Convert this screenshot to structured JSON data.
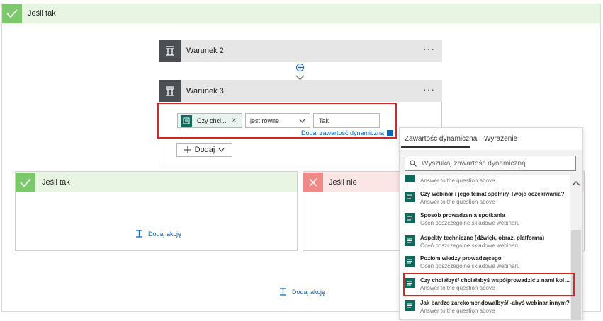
{
  "outer": {
    "title": "Jeśli tak",
    "add_action": "Dodaj akcję"
  },
  "condition2": {
    "title": "Warunek 2",
    "menu": "···"
  },
  "condition3": {
    "title": "Warunek 3",
    "menu": "···",
    "token": "Czy chci...",
    "token_remove": "×",
    "operator": "jest równe",
    "value": "Tak",
    "dynamic_link": "Dodaj zawartość dynamiczną",
    "add_button": "Dodaj"
  },
  "branch_yes": {
    "title": "Jeśli tak",
    "add_action": "Dodaj akcję"
  },
  "branch_no": {
    "title": "Jeśli nie"
  },
  "panel": {
    "tabs": [
      "Zawartość dynamiczna",
      "Wyrażenie"
    ],
    "search_placeholder": "Wyszukaj zawartość dynamiczną",
    "partial_item_sub": "Answer to the question above",
    "items": [
      {
        "title": "Czy webinar i jego temat spełniły Twoje oczekiwania?",
        "sub": "Answer to the question above"
      },
      {
        "title": "Sposób prowadzenia spotkania",
        "sub": "Oceń poszczególne składowe webinaru"
      },
      {
        "title": "Aspekty techniczne (dźwięk, obraz, platforma)",
        "sub": "Oceń poszczególne składowe webinaru"
      },
      {
        "title": "Poziom wiedzy prowadzącego",
        "sub": "Oceń poszczególne składowe webinaru"
      },
      {
        "title": "Czy chciałbyś/ chciałabyś współprowadzić z nami kolej...",
        "sub": "Answer to the question above"
      },
      {
        "title": "Jak bardzo zarekomendowałbyś/ -abyś webinar innym?",
        "sub": "Answer to the question above"
      }
    ]
  },
  "colors": {
    "accent": "#0f63b8",
    "highlight": "#d62626",
    "yes": "#7bc96a",
    "no": "#f08a86"
  }
}
